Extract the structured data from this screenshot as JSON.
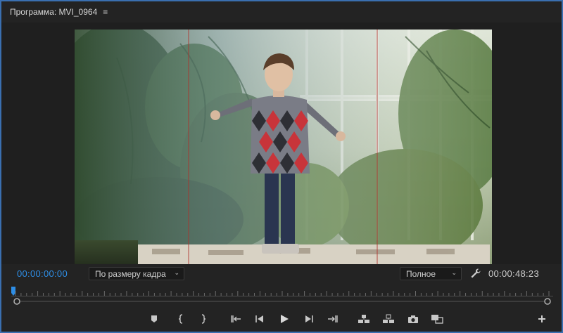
{
  "panel": {
    "title": "Программа: MVI_0964",
    "menu_icon": "hamburger-icon"
  },
  "viewer": {
    "current_timecode": "00:00:00:00",
    "fit": "По размеру кадра",
    "quality": "Полное",
    "duration": "00:00:48:23",
    "playhead_position": 0
  },
  "transport": {
    "buttons": [
      "add-marker-icon",
      "mark-in-icon",
      "mark-out-icon",
      "go-to-in-icon",
      "step-back-icon",
      "play-icon",
      "step-forward-icon",
      "go-to-out-icon",
      "lift-icon",
      "extract-icon",
      "export-frame-icon",
      "compare-view-icon",
      "add-button-icon"
    ]
  },
  "colors": {
    "accent": "#2e8ee6",
    "panel_border": "#3a6fb0",
    "guide_line": "#b0302a"
  }
}
